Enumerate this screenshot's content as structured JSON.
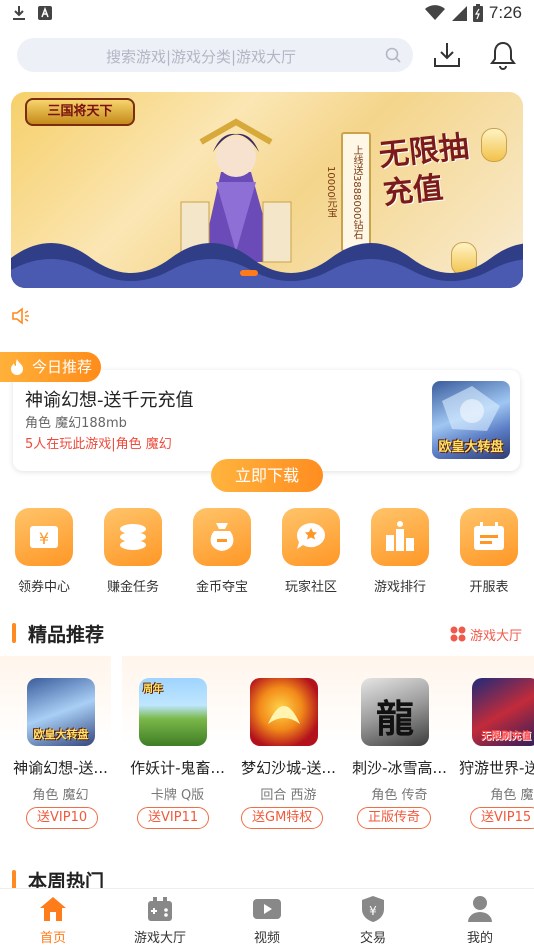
{
  "status_bar": {
    "time": "7:26",
    "left_icons": [
      "download-icon",
      "app-a-icon"
    ],
    "right_icons": [
      "wifi-icon",
      "signal-icon",
      "battery-icon"
    ]
  },
  "search": {
    "placeholder": "搜索游戏|游戏分类|游戏大厅",
    "icons": [
      "search-icon",
      "download-icon",
      "bell-icon"
    ]
  },
  "banner": {
    "logo_text": "三国将天下",
    "scroll_text": "上线送3888000钻石10000元宝",
    "headline": "无限抽充值",
    "active_dot": 0
  },
  "today": {
    "tag": "今日推荐",
    "title": "神谕幻想-送千元充值",
    "meta": "角色 魔幻188mb",
    "players": "5人在玩此游戏|角色 魔幻",
    "thumb_caption": "欧皇大转盘",
    "download_label": "立即下载"
  },
  "quick_entries": [
    {
      "label": "领券中心",
      "icon": "coupon-icon"
    },
    {
      "label": "赚金任务",
      "icon": "coins-icon"
    },
    {
      "label": "金币夺宝",
      "icon": "money-bag-icon"
    },
    {
      "label": "玩家社区",
      "icon": "community-icon"
    },
    {
      "label": "游戏排行",
      "icon": "ranking-icon"
    },
    {
      "label": "开服表",
      "icon": "calendar-icon"
    }
  ],
  "featured": {
    "title": "精品推荐",
    "more_label": "游戏大厅",
    "games": [
      {
        "name": "神谕幻想-送...",
        "tags": "角色 魔幻",
        "badge": "送VIP10",
        "thumb_caption": "欧皇大转盘"
      },
      {
        "name": "作妖计-鬼畜...",
        "tags": "卡牌 Q版",
        "badge": "送VIP11",
        "thumb_caption": "周年"
      },
      {
        "name": "梦幻沙城-送...",
        "tags": "回合 西游",
        "badge": "送GM特权",
        "thumb_caption": ""
      },
      {
        "name": "刺沙-冰雪高...",
        "tags": "角色 传奇",
        "badge": "正版传奇",
        "thumb_caption": "龍"
      },
      {
        "name": "狩游世界-送",
        "tags": "角色 魔幻",
        "badge": "送VIP15",
        "thumb_caption": "无限刷充值"
      }
    ]
  },
  "weekly": {
    "title": "本周热门"
  },
  "bottom_nav": [
    {
      "label": "首页",
      "icon": "home-icon",
      "active": true
    },
    {
      "label": "游戏大厅",
      "icon": "game-hall-icon",
      "active": false
    },
    {
      "label": "视频",
      "icon": "video-icon",
      "active": false
    },
    {
      "label": "交易",
      "icon": "trade-shield-icon",
      "active": false
    },
    {
      "label": "我的",
      "icon": "profile-icon",
      "active": false
    }
  ],
  "colors": {
    "accent": "#ff8a22",
    "price_red": "#ef4b3c",
    "search_bg": "#eef0f7"
  }
}
